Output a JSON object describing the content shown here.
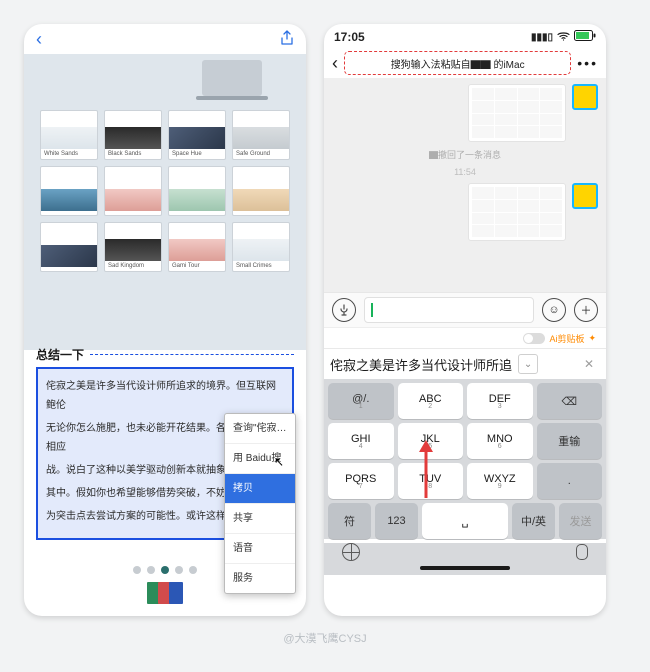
{
  "watermark": "@大漠飞鹰CYSJ",
  "left": {
    "tiles": [
      "White Sands",
      "Black Sands",
      "Space Hue",
      "Safe Ground",
      "",
      "",
      "",
      "",
      "",
      "Sad Kingdom",
      "Gami Tour",
      "Small Crimes"
    ],
    "summary_title": "总结一下",
    "paragraphs": [
      "侘寂之美是许多当代设计师所追求的境界。但互联网鲍伦",
      "无论你怎么施肥，也未必能开花结果。各种方案也会相应",
      "战。说白了这种以美学驱动创新本就抽象不",
      "其中。假如你也希望能够借势突破，不妨以",
      "为突击点去尝试方案的可能性。或许这样说"
    ],
    "menu": {
      "lookup": "查询\"侘寂…",
      "baidu": "用 Baidu搜",
      "copy": "拷贝",
      "share": "共享",
      "speech": "语音",
      "services": "服务"
    }
  },
  "right": {
    "time": "17:05",
    "title": "搜狗输入法粘贴自▇▇ 的iMac",
    "recall": "▇撤回了一条消息",
    "timestamp": "11:54",
    "ai_label": "Ai剪贴板",
    "candidate": "侘寂之美是许多当代设计师所追",
    "keys_row1": [
      "@/.",
      "ABC",
      "DEF",
      "⌫"
    ],
    "keys_row2": [
      "GHI",
      "JKL",
      "MNO",
      "重输"
    ],
    "keys_row3": [
      "PQRS",
      "TUV",
      "WXYZ",
      "."
    ],
    "keys_row4_sym": "符",
    "keys_row4_123": "123",
    "keys_row4_cn": "中/英",
    "keys_row4_send": "发送",
    "keys_nums": [
      "1",
      "2",
      "3",
      "4",
      "5",
      "6",
      "7",
      "8",
      "9"
    ],
    "space_label": "␣"
  }
}
